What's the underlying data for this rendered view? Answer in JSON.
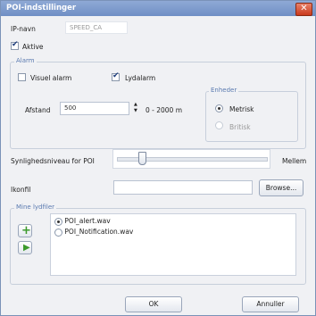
{
  "window": {
    "title": "POI-indstillinger",
    "close_glyph": "✕"
  },
  "ip_name": {
    "label": "IP-navn",
    "value": "SPEED_CA"
  },
  "active": {
    "label": "Aktive",
    "checked": true
  },
  "alarm": {
    "legend": "Alarm",
    "visual_label": "Visuel alarm",
    "visual_checked": false,
    "sound_label": "Lydalarm",
    "sound_checked": true,
    "distance_label": "Afstand",
    "distance_value": "500",
    "range_text": "0 - 2000 m"
  },
  "units": {
    "legend": "Enheder",
    "metric_label": "Metrisk",
    "british_label": "Britisk",
    "selected": "metric"
  },
  "visibility": {
    "label": "Synlighedsniveau for POI",
    "value_label": "Mellem",
    "level_fraction": 0.15
  },
  "icon": {
    "label": "Ikonfil",
    "value": "",
    "browse_label": "Browse..."
  },
  "sounds": {
    "legend": "Mine lydfiler",
    "files": [
      "POI_alert.wav",
      "POI_Notification.wav"
    ],
    "selected_index": 0,
    "add_icon": "plus-icon",
    "play_icon": "play-icon"
  },
  "footer": {
    "ok_label": "OK",
    "cancel_label": "Annuller"
  },
  "colors": {
    "title_bar": "#7a97cc",
    "close": "#d5502f",
    "add_green": "#3c9a2c"
  }
}
